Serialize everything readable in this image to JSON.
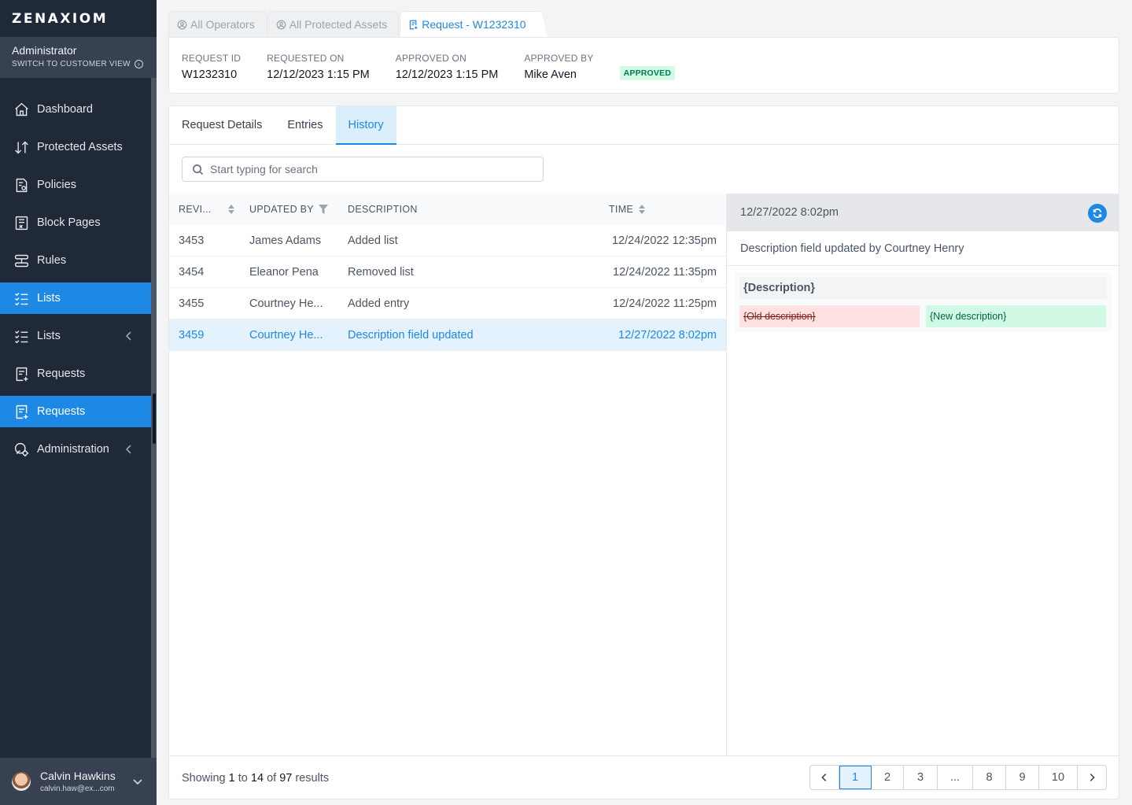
{
  "app": {
    "logo": "ZENAXIOM",
    "role": "Administrator",
    "switch_view": "SWITCH TO CUSTOMER VIEW"
  },
  "nav": {
    "dashboard": "Dashboard",
    "protected_assets": "Protected Assets",
    "policies": "Policies",
    "block_pages": "Block Pages",
    "rules": "Rules",
    "lists_active": "Lists",
    "lists": "Lists",
    "requests": "Requests",
    "requests_active": "Requests",
    "administration": "Administration"
  },
  "user": {
    "name": "Calvin Hawkins",
    "email": "calvin.haw@ex...com"
  },
  "tabs": {
    "operators": "All Operators",
    "assets": "All Protected Assets",
    "request": "Request - W1232310"
  },
  "summary": {
    "request_id_label": "REQUEST ID",
    "request_id": "W1232310",
    "requested_on_label": "REQUESTED ON",
    "requested_on": "12/12/2023 1:15 PM",
    "approved_on_label": "APPROVED ON",
    "approved_on": "12/12/2023 1:15 PM",
    "approved_by_label": "APPROVED BY",
    "approved_by": "Mike Aven",
    "status": "APPROVED"
  },
  "subtabs": {
    "details": "Request Details",
    "entries": "Entries",
    "history": "History"
  },
  "search": {
    "placeholder": "Start typing for search"
  },
  "table": {
    "headers": {
      "revision": "REVI...",
      "updated_by": "UPDATED BY",
      "description": "DESCRIPTION",
      "time": "TIME"
    },
    "rows": [
      {
        "revision": "3453",
        "updated_by": "James Adams",
        "description": "Added list",
        "time": "12/24/2022 12:35pm"
      },
      {
        "revision": "3454",
        "updated_by": "Eleanor Pena",
        "description": "Removed list",
        "time": "12/24/2022 11:35pm"
      },
      {
        "revision": "3455",
        "updated_by": "Courtney He...",
        "description": "Added entry",
        "time": "12/24/2022 11:25pm"
      },
      {
        "revision": "3459",
        "updated_by": "Courtney He...",
        "description": "Description field updated",
        "time": "12/27/2022 8:02pm"
      }
    ]
  },
  "detail": {
    "time": "12/27/2022 8:02pm",
    "summary": "Description field updated by Courtney Henry",
    "field": "{Description}",
    "old_value": "{Old description}",
    "new_value": "{New description}"
  },
  "footer": {
    "showing": "Showing",
    "from": "1",
    "to_word": "to",
    "to": "14",
    "of_word": "of",
    "total": "97",
    "results_word": "results"
  },
  "pagination": {
    "pages": [
      "1",
      "2",
      "3",
      "...",
      "8",
      "9",
      "10"
    ]
  },
  "colors": {
    "accent": "#1e88e5",
    "sidebar": "#1f2937",
    "badge_bg": "#d1fae5",
    "badge_text": "#047857"
  }
}
